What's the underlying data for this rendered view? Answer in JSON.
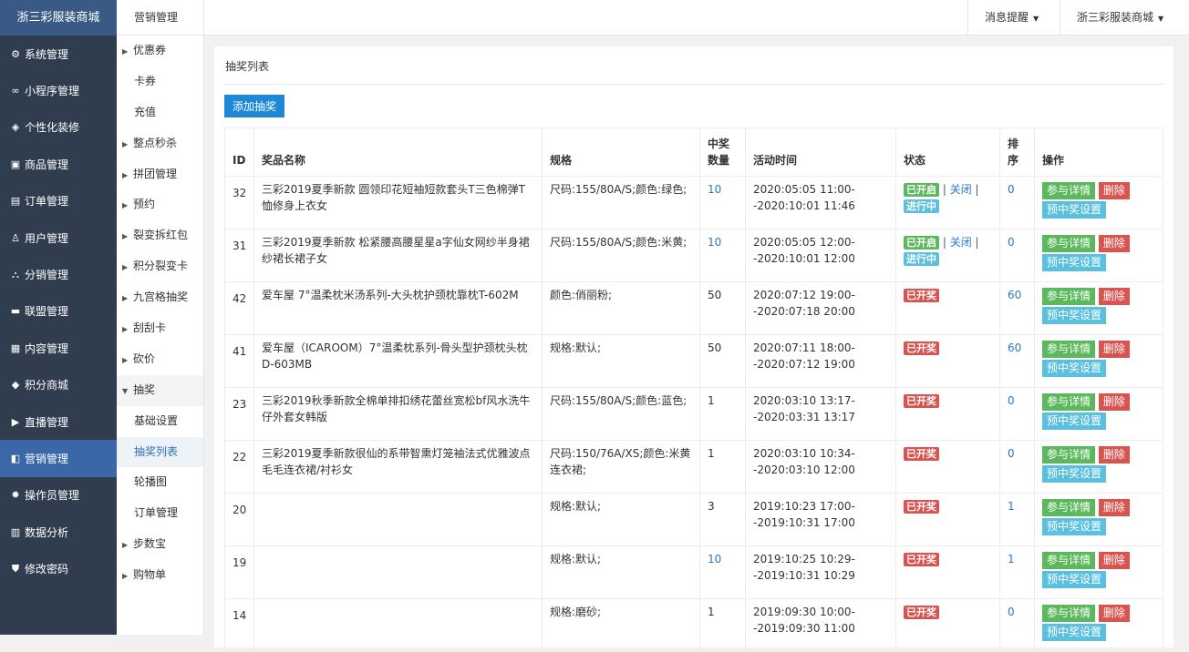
{
  "sidebar": {
    "brand": "浙三彩服装商城",
    "items": [
      {
        "icon": "gear-icon",
        "glyph": "⚙",
        "label": "系统管理"
      },
      {
        "icon": "link-icon",
        "glyph": "∞",
        "label": "小程序管理"
      },
      {
        "icon": "paint-icon",
        "glyph": "◈",
        "label": "个性化装修"
      },
      {
        "icon": "shop-icon",
        "glyph": "▣",
        "label": "商品管理"
      },
      {
        "icon": "clipboard-icon",
        "glyph": "▤",
        "label": "订单管理"
      },
      {
        "icon": "user-icon",
        "glyph": "♙",
        "label": "用户管理"
      },
      {
        "icon": "sitemap-icon",
        "glyph": "⛬",
        "label": "分销管理"
      },
      {
        "icon": "credit-card-icon",
        "glyph": "▬",
        "label": "联盟管理"
      },
      {
        "icon": "news-icon",
        "glyph": "▦",
        "label": "内容管理"
      },
      {
        "icon": "cube-icon",
        "glyph": "◆",
        "label": "积分商城"
      },
      {
        "icon": "play-icon",
        "glyph": "▶",
        "label": "直播管理"
      },
      {
        "icon": "marketing-icon",
        "glyph": "◧",
        "label": "营销管理"
      },
      {
        "icon": "cog-icon",
        "glyph": "✹",
        "label": "操作员管理"
      },
      {
        "icon": "chart-icon",
        "glyph": "▥",
        "label": "数据分析"
      },
      {
        "icon": "shield-icon",
        "glyph": "⛊",
        "label": "修改密码"
      }
    ]
  },
  "subnav": {
    "title": "营销管理",
    "items": [
      {
        "label": "优惠券",
        "arrow": "▶"
      },
      {
        "label": "卡券",
        "arrow": ""
      },
      {
        "label": "充值",
        "arrow": ""
      },
      {
        "label": "整点秒杀",
        "arrow": "▶"
      },
      {
        "label": "拼团管理",
        "arrow": "▶"
      },
      {
        "label": "预约",
        "arrow": "▶"
      },
      {
        "label": "裂变拆红包",
        "arrow": "▶"
      },
      {
        "label": "积分裂变卡",
        "arrow": "▶"
      },
      {
        "label": "九宫格抽奖",
        "arrow": "▶"
      },
      {
        "label": "刮刮卡",
        "arrow": "▶"
      },
      {
        "label": "砍价",
        "arrow": "▶"
      },
      {
        "label": "抽奖",
        "arrow": "▼"
      },
      {
        "label": "基础设置",
        "arrow": ""
      },
      {
        "label": "抽奖列表",
        "arrow": ""
      },
      {
        "label": "轮播图",
        "arrow": ""
      },
      {
        "label": "订单管理",
        "arrow": ""
      },
      {
        "label": "步数宝",
        "arrow": "▶"
      },
      {
        "label": "购物单",
        "arrow": "▶"
      }
    ]
  },
  "topbar": {
    "notice": "消息提醒",
    "store": "浙三彩服装商城",
    "caret": "▼"
  },
  "page": {
    "title": "抽奖列表",
    "add_button": "添加抽奖"
  },
  "table": {
    "headers": {
      "id": "ID",
      "name": "奖品名称",
      "spec": "规格",
      "count": "中奖数量",
      "time": "活动时间",
      "status": "状态",
      "sort": "排序",
      "ops": "操作"
    },
    "labels": {
      "open": "已开启",
      "sep": "|",
      "close": "关闭",
      "running": "进行中",
      "drawn": "已开奖",
      "detail": "参与详情",
      "delete": "删除",
      "preset": "预中奖设置"
    },
    "rows": [
      {
        "id": "32",
        "name": "三彩2019夏季新款 圆领印花短袖短款套头T三色棉弹T恤修身上衣女",
        "spec": "尺码:155/80A/S;颜色:绿色;",
        "count": "10",
        "time1": "2020:05:05 11:00-",
        "time2": "-2020:10:01 11:46",
        "status": "active",
        "sort": "0"
      },
      {
        "id": "31",
        "name": "三彩2019夏季新款 松紧腰高腰星星a字仙女网纱半身裙纱裙长裙子女",
        "spec": "尺码:155/80A/S;颜色:米黄;",
        "count": "10",
        "time1": "2020:05:05 12:00-",
        "time2": "-2020:10:01 12:00",
        "status": "active",
        "sort": "0"
      },
      {
        "id": "42",
        "name": "爱车屋 7°温柔枕米汤系列-大头枕护颈枕靠枕T-602M",
        "spec": "颜色:俏丽粉;",
        "count": "50",
        "time1": "2020:07:12 19:00-",
        "time2": "-2020:07:18 20:00",
        "status": "drawn",
        "sort": "60"
      },
      {
        "id": "41",
        "name": "爱车屋（ICAROOM）7°温柔枕系列-骨头型护颈枕头枕D-603MB",
        "spec": "规格:默认;",
        "count": "50",
        "time1": "2020:07:11 18:00-",
        "time2": "-2020:07:12 19:00",
        "status": "drawn",
        "sort": "60"
      },
      {
        "id": "23",
        "name": "三彩2019秋季新款全棉单排扣绣花蕾丝宽松bf风水洗牛仔外套女韩版",
        "spec": "尺码:155/80A/S;颜色:蓝色;",
        "count": "1",
        "time1": "2020:03:10 13:17-",
        "time2": "-2020:03:31 13:17",
        "status": "drawn",
        "sort": "0"
      },
      {
        "id": "22",
        "name": "三彩2019夏季新款很仙的系带智熏灯笼袖法式优雅波点毛毛连衣裙/衬衫女",
        "spec": "尺码:150/76A/XS;颜色:米黄连衣裙;",
        "count": "1",
        "time1": "2020:03:10 10:34-",
        "time2": "-2020:03:10 12:00",
        "status": "drawn",
        "sort": "0"
      },
      {
        "id": "20",
        "name": "",
        "spec": "规格:默认;",
        "count": "3",
        "time1": "2019:10:23 17:00-",
        "time2": "-2019:10:31 17:00",
        "status": "drawn",
        "sort": "1"
      },
      {
        "id": "19",
        "name": "",
        "spec": "规格:默认;",
        "count": "10",
        "time1": "2019:10:25 10:29-",
        "time2": "-2019:10:31 10:29",
        "status": "drawn",
        "sort": "1"
      },
      {
        "id": "14",
        "name": "",
        "spec": "规格:磨砂;",
        "count": "1",
        "time1": "2019:09:30 10:00-",
        "time2": "-2019:09:30 11:00",
        "status": "drawn",
        "sort": "0"
      }
    ]
  }
}
